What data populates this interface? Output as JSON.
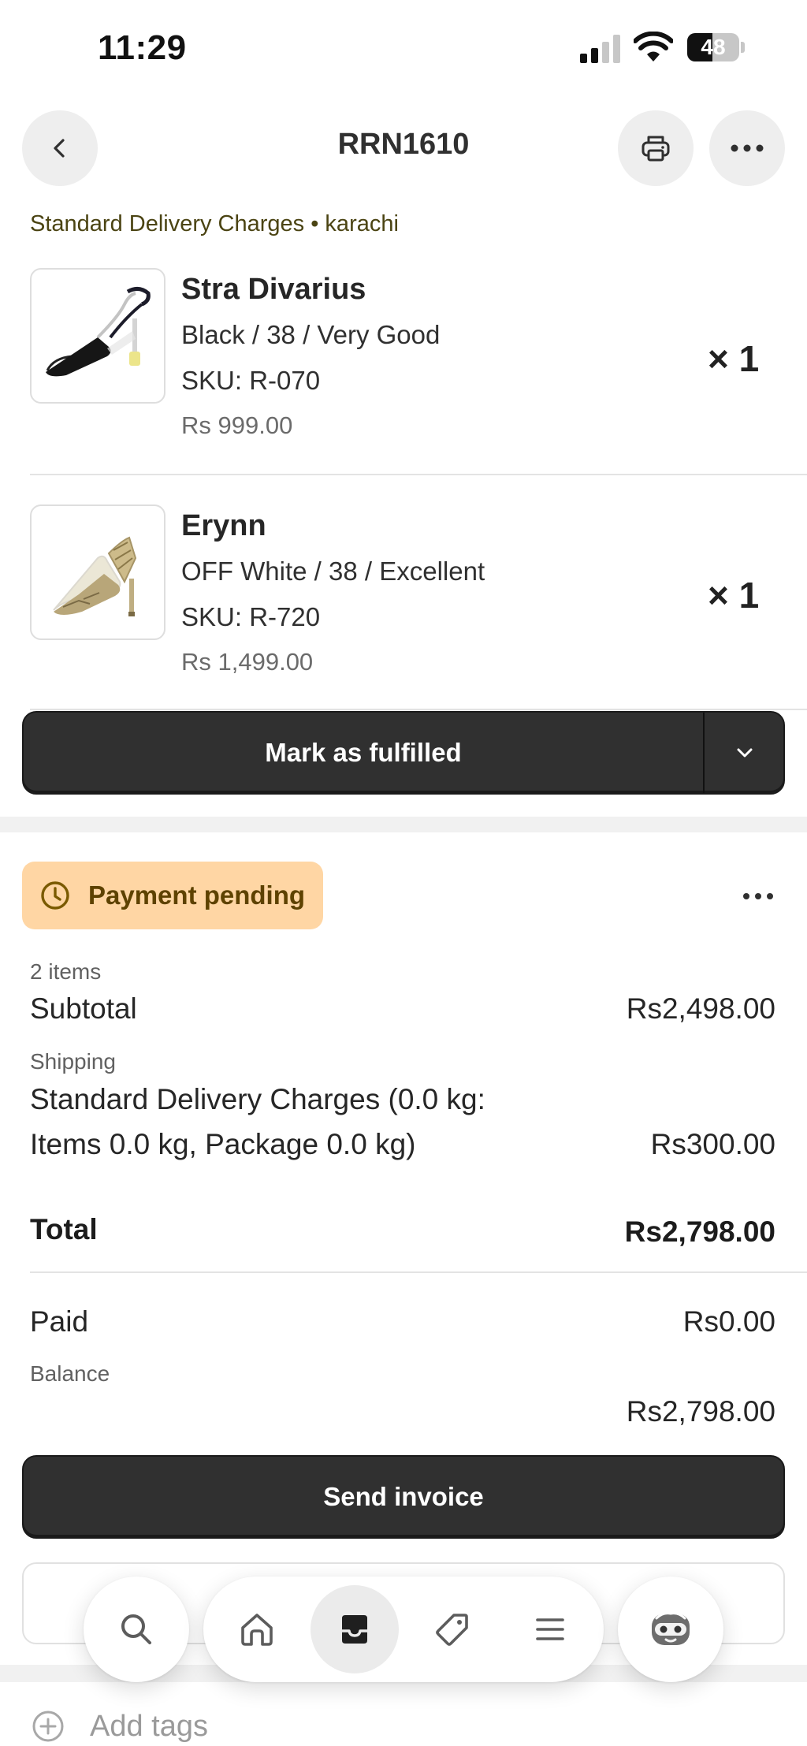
{
  "status_bar": {
    "time": "11:29",
    "battery": "48",
    "battery_level": 0.48
  },
  "header": {
    "title": "RRN1610"
  },
  "delivery_label": "Standard Delivery Charges • karachi",
  "line_items": [
    {
      "title": "Stra Divarius",
      "variant": "Black / 38 / Very Good",
      "sku": "SKU: R-070",
      "price": "Rs 999.00",
      "quantity": "× 1"
    },
    {
      "title": "Erynn",
      "variant": "OFF White / 38 / Excellent",
      "sku": "SKU: R-720",
      "price": "Rs 1,499.00",
      "quantity": "× 1"
    }
  ],
  "fulfill": {
    "label": "Mark as fulfilled"
  },
  "payment": {
    "status": "Payment pending",
    "items_count": "2 items",
    "subtotal_label": "Subtotal",
    "subtotal_value": "Rs2,498.00",
    "shipping_label": "Shipping",
    "shipping_desc_line1": "Standard Delivery Charges (0.0 kg:",
    "shipping_desc_line2": "Items 0.0 kg, Package 0.0 kg)",
    "shipping_value": "Rs300.00",
    "total_label": "Total",
    "total_value": "Rs2,798.00",
    "paid_label": "Paid",
    "paid_value": "Rs0.00",
    "balance_label": "Balance",
    "balance_value": "Rs2,798.00"
  },
  "send_invoice": {
    "label": "Send invoice"
  },
  "tags": {
    "placeholder": "Add tags"
  },
  "tab_bar": {
    "items": [
      {
        "icon": "search-icon"
      },
      {
        "icon": "home-icon"
      },
      {
        "icon": "orders-icon",
        "active": true
      },
      {
        "icon": "tag-icon"
      },
      {
        "icon": "menu-icon"
      },
      {
        "icon": "avatar-icon"
      }
    ]
  },
  "colors": {
    "primary_button": "#303030",
    "pending_badge": "#ffd6a4",
    "pending_text": "#5e4200",
    "delivery_text": "#4b4413"
  }
}
